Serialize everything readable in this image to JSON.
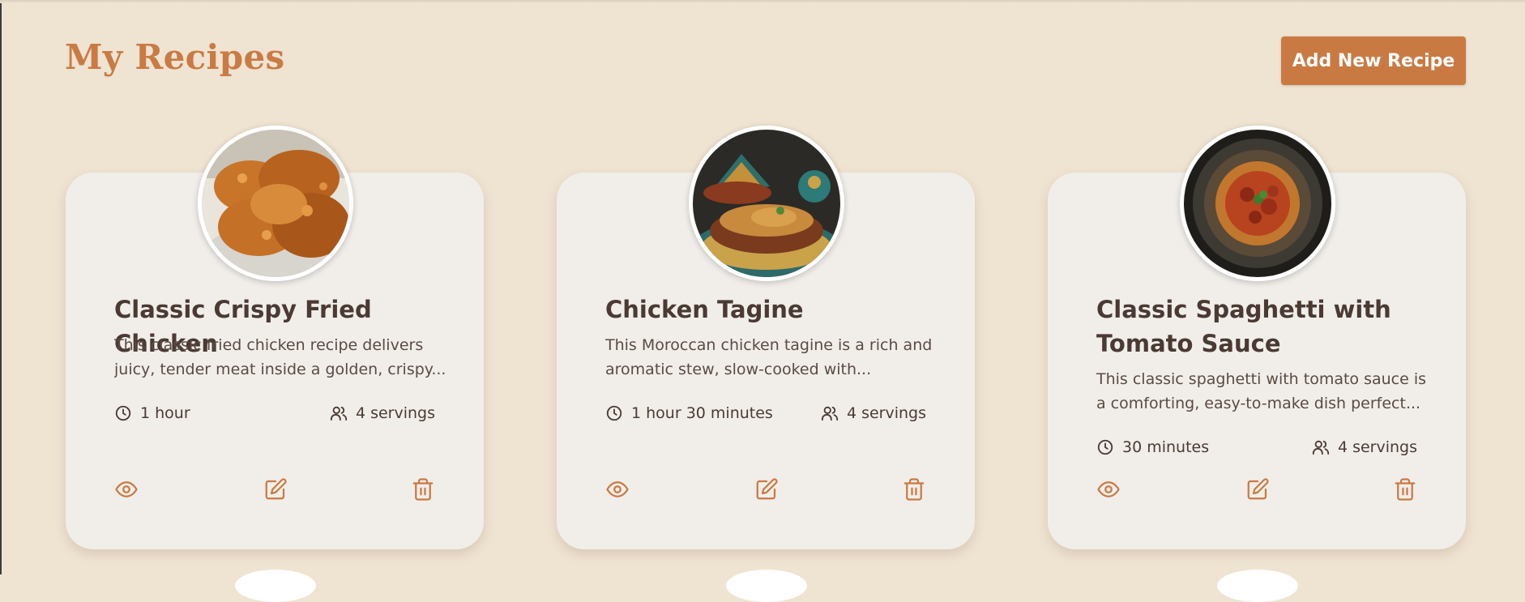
{
  "header": {
    "title": "My Recipes",
    "add_button_label": "Add New Recipe"
  },
  "colors": {
    "background": "#efe3d2",
    "accent": "#c97a43",
    "card": "#f1eeea",
    "text": "#4a3a33"
  },
  "recipes": [
    {
      "title": "Classic Crispy Fried Chicken",
      "description": "This classic fried chicken recipe delivers juicy, tender meat inside a golden, crispy...",
      "time": "1 hour",
      "servings": "4 servings",
      "image_icon": "fried-chicken-photo"
    },
    {
      "title": "Chicken Tagine",
      "description": "This Moroccan chicken tagine is a rich and aromatic stew, slow-cooked with...",
      "time": "1 hour 30 minutes",
      "servings": "4 servings",
      "image_icon": "tagine-photo"
    },
    {
      "title": "Classic Spaghetti with Tomato Sauce",
      "description": "This classic spaghetti with tomato sauce is a comforting, easy-to-make dish perfect...",
      "time": "30 minutes",
      "servings": "4 servings",
      "image_icon": "spaghetti-photo"
    }
  ],
  "icons": {
    "time": "clock-icon",
    "servings": "users-icon",
    "view": "eye-icon",
    "edit": "edit-icon",
    "delete": "trash-icon"
  }
}
